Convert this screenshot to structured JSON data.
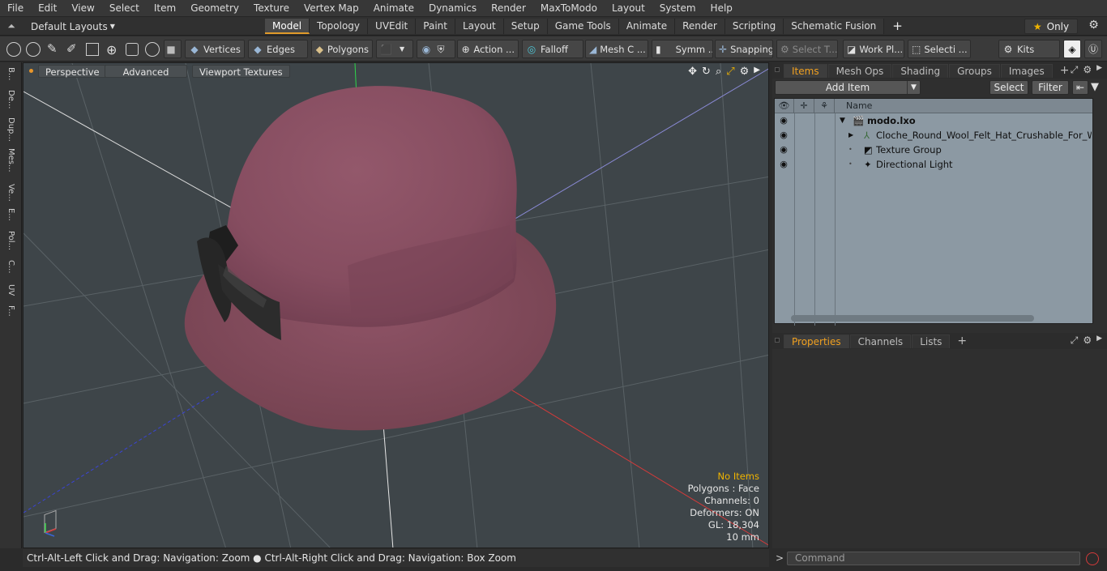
{
  "menu": [
    "File",
    "Edit",
    "View",
    "Select",
    "Item",
    "Geometry",
    "Texture",
    "Vertex Map",
    "Animate",
    "Dynamics",
    "Render",
    "MaxToModo",
    "Layout",
    "System",
    "Help"
  ],
  "layouts_label": "Default Layouts",
  "tabs": [
    "Model",
    "Topology",
    "UVEdit",
    "Paint",
    "Layout",
    "Setup",
    "Game Tools",
    "Animate",
    "Render",
    "Scripting",
    "Schematic Fusion"
  ],
  "only_label": "Only",
  "toolbar": {
    "vertices": "Vertices",
    "edges": "Edges",
    "polygons": "Polygons",
    "action": "Action ...",
    "falloff": "Falloff",
    "mesh": "Mesh C ...",
    "symm": "Symm ...",
    "snapping": "Snapping",
    "select_t": "Select T...",
    "work_pl": "Work Pl...",
    "selecti": "Selecti ...",
    "kits": "Kits"
  },
  "left_strip": [
    "B...",
    "De...",
    "Dup...",
    "Mes...",
    "Ve...",
    "E...",
    "Pol...",
    "C...",
    "UV",
    "F..."
  ],
  "viewport": {
    "perspective": "Perspective",
    "advanced": "Advanced",
    "textures": "Viewport Textures",
    "info": {
      "no_items": "No Items",
      "polygons": "Polygons : Face",
      "channels": "Channels: 0",
      "deformers": "Deformers: ON",
      "gl": "GL: 18,304",
      "scale": "10 mm"
    }
  },
  "status": "Ctrl-Alt-Left Click and Drag: Navigation: Zoom ● Ctrl-Alt-Right Click and Drag: Navigation: Box Zoom",
  "items_panel": {
    "tabs": [
      "Items",
      "Mesh Ops",
      "Shading",
      "Groups",
      "Images"
    ],
    "add_item": "Add Item",
    "select": "Select",
    "filter": "Filter",
    "col_name": "Name",
    "rows": [
      {
        "label": "modo.lxo"
      },
      {
        "label": "Cloche_Round_Wool_Felt_Hat_Crushable_For_Wo ..."
      },
      {
        "label": "Texture Group"
      },
      {
        "label": "Directional Light"
      }
    ]
  },
  "props_panel": {
    "tabs": [
      "Properties",
      "Channels",
      "Lists"
    ]
  },
  "command_placeholder": "Command",
  "colors": {
    "accent": "#f0a020",
    "hat": "#8e5366",
    "viewport_bg": "#3e4549"
  }
}
